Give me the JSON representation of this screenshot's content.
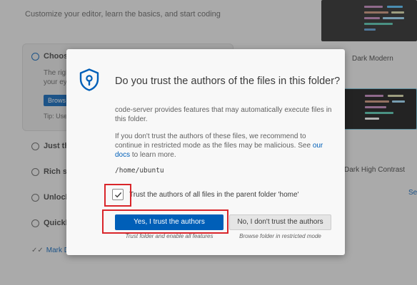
{
  "welcome": {
    "subtitle": "Customize your editor, learn the basics, and start coding",
    "steps": [
      {
        "label": "Choose"
      },
      {
        "label": "Just the"
      },
      {
        "label": "Rich su"
      },
      {
        "label": "Unlock"
      },
      {
        "label": "Quickly"
      }
    ],
    "active_desc_line1": "The righ",
    "active_desc_line2": "your ey",
    "active_button": "Brows",
    "tip": "Tip: Use",
    "mark_done": "Mark Do",
    "themes": [
      {
        "label": "Dark Modern"
      },
      {
        "label": "Dark High Contrast"
      }
    ],
    "see_more": "See"
  },
  "dialog": {
    "icon": "shield-keyhole-icon",
    "title": "Do you trust the authors of the files in this folder?",
    "paragraph1": "code-server provides features that may automatically execute files in this folder.",
    "paragraph2_before": "If you don't trust the authors of these files, we recommend to continue in restricted mode as the files may be malicious. See ",
    "paragraph2_link": "our docs",
    "paragraph2_after": " to learn more.",
    "path": "/home/ubuntu",
    "checkbox_checked": true,
    "checkbox_label": "Trust the authors of all files in the parent folder 'home'",
    "primary_button": "Yes, I trust the authors",
    "primary_caption": "Trust folder and enable all features",
    "secondary_button": "No, I don't trust the authors",
    "secondary_caption": "Browse folder in restricted mode"
  },
  "colors": {
    "accent": "#005fb8",
    "highlight": "#d9252a"
  }
}
